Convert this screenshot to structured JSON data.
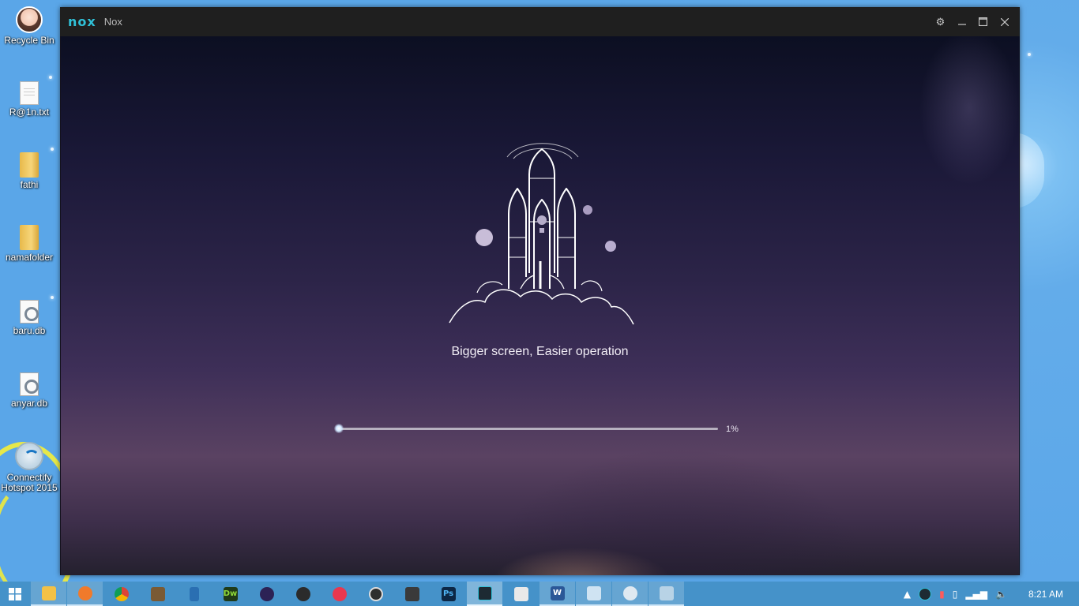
{
  "desktop": {
    "icons": [
      {
        "label": "Recycle Bin",
        "icon": "recycle-bin-avatar-icon"
      },
      {
        "label": "R@1n.txt",
        "icon": "text-file-icon"
      },
      {
        "label": "fathi",
        "icon": "folder-icon"
      },
      {
        "label": "namafolder",
        "icon": "folder-icon"
      },
      {
        "label": "baru.db",
        "icon": "database-file-icon"
      },
      {
        "label": "anyar.db",
        "icon": "database-file-icon"
      },
      {
        "label": "Connectify Hotspot 2015",
        "icon": "wifi-hotspot-icon"
      }
    ]
  },
  "window": {
    "logo": "nox",
    "title": "Nox",
    "controls": [
      "settings",
      "minimize",
      "maximize",
      "close"
    ],
    "slogan": "Bigger screen, Easier operation",
    "progress": {
      "value_percent": 1,
      "label": "1%"
    }
  },
  "taskbar": {
    "apps": [
      {
        "name": "file-explorer",
        "state": "open"
      },
      {
        "name": "ucbrowser",
        "state": "open"
      },
      {
        "name": "chrome",
        "state": "closed"
      },
      {
        "name": "app-4",
        "state": "closed"
      },
      {
        "name": "app-5",
        "state": "closed"
      },
      {
        "name": "dreamweaver",
        "state": "closed",
        "glyph": "Dw"
      },
      {
        "name": "eclipse",
        "state": "closed"
      },
      {
        "name": "app-8",
        "state": "closed"
      },
      {
        "name": "itunes",
        "state": "closed"
      },
      {
        "name": "app-10",
        "state": "closed"
      },
      {
        "name": "app-11",
        "state": "closed"
      },
      {
        "name": "photoshop",
        "state": "closed",
        "glyph": "Ps"
      },
      {
        "name": "nox",
        "state": "active"
      },
      {
        "name": "app-14",
        "state": "closed"
      },
      {
        "name": "word",
        "state": "open",
        "glyph": "W"
      },
      {
        "name": "notepad",
        "state": "open"
      },
      {
        "name": "app-17",
        "state": "open"
      },
      {
        "name": "app-18",
        "state": "open"
      }
    ],
    "clock": "8:21 AM"
  },
  "colors": {
    "nox_accent": "#30c1d8",
    "taskbar": "#4592c9",
    "desktop": "#5aa6e8"
  }
}
